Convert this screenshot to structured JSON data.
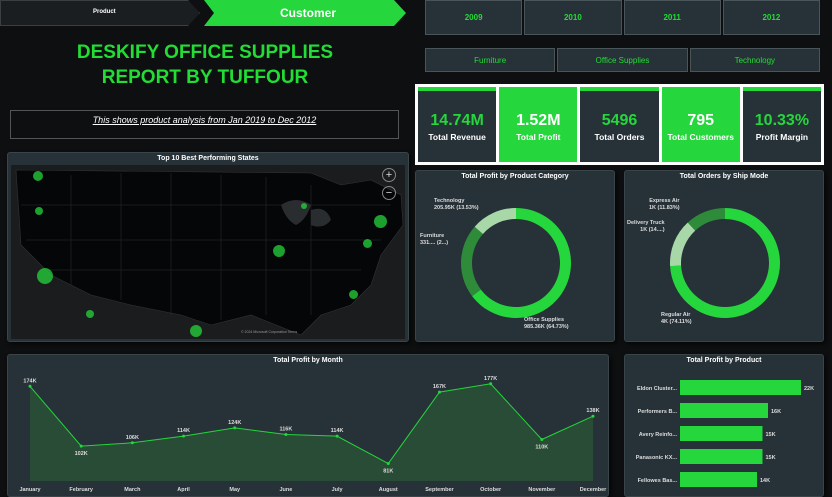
{
  "nav": {
    "left_label": "Product",
    "right_label": "Customer"
  },
  "header": {
    "title_line1": "DESKIFY OFFICE SUPPLIES",
    "title_line2": "REPORT BY TUFFOUR",
    "subtitle": "This shows product analysis from Jan 2019 to Dec 2012"
  },
  "years": [
    "2009",
    "2010",
    "2011",
    "2012"
  ],
  "categories": [
    "Furniture",
    "Office Supplies",
    "Technology"
  ],
  "kpis": [
    {
      "value": "14.74M",
      "label": "Total Revenue",
      "style": "dark"
    },
    {
      "value": "1.52M",
      "label": "Total Profit",
      "style": "green"
    },
    {
      "value": "5496",
      "label": "Total Orders",
      "style": "dark"
    },
    {
      "value": "795",
      "label": "Total Customers",
      "style": "green"
    },
    {
      "value": "10.33%",
      "label": "Profit Margin",
      "style": "dark"
    }
  ],
  "map": {
    "title": "Top 10 Best Performing States",
    "attribution": "© 2024 Microsoft Corporation  Terms",
    "zoom_in": "+",
    "zoom_out": "−"
  },
  "colors": {
    "accent": "#25d63c",
    "panel": "#263238",
    "background": "#0d0f10"
  },
  "chart_data": [
    {
      "type": "pie",
      "title": "Total Profit by Product Category",
      "labels": [
        "Office Supplies",
        "Furniture",
        "Technology"
      ],
      "values": [
        985.36,
        331,
        205.95
      ],
      "value_labels": [
        "985.36K (64.73%)",
        "331.... (2...)",
        "205.95K (13.53%)"
      ],
      "colors": [
        "#25d63c",
        "#2e8b3a",
        "#a8d8a8"
      ]
    },
    {
      "type": "pie",
      "title": "Total Orders by Ship Mode",
      "labels": [
        "Regular Air",
        "Delivery Truck",
        "Express Air"
      ],
      "values": [
        4,
        1,
        1
      ],
      "value_labels": [
        "4K (74.11%)",
        "1K (14....)",
        "1K (11.83%)"
      ],
      "percents": [
        74.11,
        14.06,
        11.83
      ],
      "colors": [
        "#25d63c",
        "#a8d8a8",
        "#2e8b3a"
      ]
    },
    {
      "type": "area",
      "title": "Total Profit by Month",
      "categories": [
        "January",
        "February",
        "March",
        "April",
        "May",
        "June",
        "July",
        "August",
        "September",
        "October",
        "November",
        "December"
      ],
      "values": [
        174,
        102,
        106,
        114,
        124,
        116,
        114,
        81,
        167,
        177,
        110,
        138
      ],
      "value_labels": [
        "174K",
        "102K",
        "106K",
        "114K",
        "124K",
        "116K",
        "114K",
        "81K",
        "167K",
        "177K",
        "110K",
        "138K"
      ]
    },
    {
      "type": "bar",
      "title": "Total Profit by Product",
      "categories": [
        "Eldon Cluster...",
        "Performers B...",
        "Avery Reinfo...",
        "Panasonic KX...",
        "Fellowes Bas..."
      ],
      "values": [
        22,
        16,
        15,
        15,
        14
      ],
      "value_labels": [
        "22K",
        "16K",
        "15K",
        "15K",
        "14K"
      ]
    }
  ]
}
